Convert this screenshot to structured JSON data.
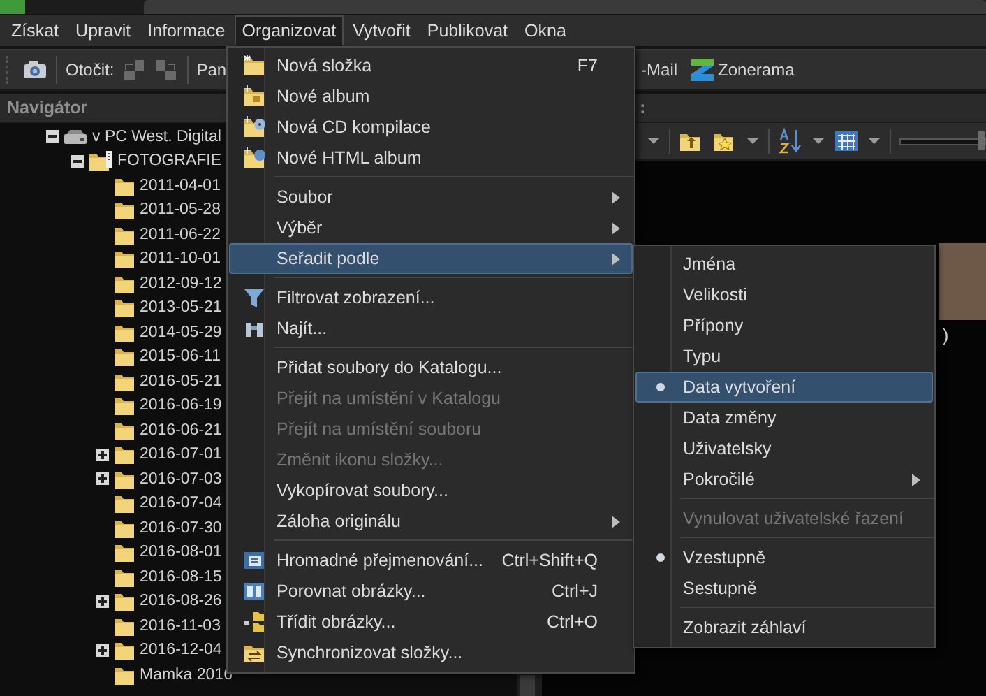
{
  "menubar": [
    {
      "label": "Získat",
      "selected": false
    },
    {
      "label": "Upravit",
      "selected": false
    },
    {
      "label": "Informace",
      "selected": false
    },
    {
      "label": "Organizovat",
      "selected": true
    },
    {
      "label": "Vytvořit",
      "selected": false
    },
    {
      "label": "Publikovat",
      "selected": false
    },
    {
      "label": "Okna",
      "selected": false
    }
  ],
  "toolbar": {
    "rotate_label": "Otočit:",
    "pan_label": "Pan",
    "mail_label": "-Mail",
    "zonerama_label": "Zonerama"
  },
  "navigator": {
    "title": "Navigátor",
    "tree": [
      {
        "label": "v PC West. Digital",
        "kind": "branch",
        "expanded": true,
        "children": [
          {
            "label": "FOTOGRAFIE",
            "kind": "branch",
            "expanded": true,
            "children": [
              {
                "label": "2011-04-01",
                "kind": "leaf"
              },
              {
                "label": "2011-05-28",
                "kind": "leaf"
              },
              {
                "label": "2011-06-22",
                "kind": "leaf"
              },
              {
                "label": "2011-10-01",
                "kind": "leaf"
              },
              {
                "label": "2012-09-12",
                "kind": "leaf"
              },
              {
                "label": "2013-05-21",
                "kind": "leaf"
              },
              {
                "label": "2014-05-29",
                "kind": "leaf"
              },
              {
                "label": "2015-06-11",
                "kind": "leaf"
              },
              {
                "label": "2016-05-21",
                "kind": "leaf"
              },
              {
                "label": "2016-06-19",
                "kind": "leaf"
              },
              {
                "label": "2016-06-21",
                "kind": "leaf"
              },
              {
                "label": "2016-07-01",
                "kind": "branch",
                "expanded": false
              },
              {
                "label": "2016-07-03",
                "kind": "branch",
                "expanded": false
              },
              {
                "label": "2016-07-04",
                "kind": "leaf"
              },
              {
                "label": "2016-07-30",
                "kind": "leaf"
              },
              {
                "label": "2016-08-01",
                "kind": "leaf"
              },
              {
                "label": "2016-08-15",
                "kind": "leaf"
              },
              {
                "label": "2016-08-26",
                "kind": "branch",
                "expanded": false
              },
              {
                "label": "2016-11-03",
                "kind": "leaf"
              },
              {
                "label": "2016-12-04",
                "kind": "branch",
                "expanded": false
              },
              {
                "label": "Mamka 2016",
                "kind": "leaf"
              }
            ]
          }
        ]
      }
    ]
  },
  "viewer": {
    "header": ":",
    "zoom_slider": {
      "level": 1
    },
    "thumbnail_caption": ")"
  },
  "menu": {
    "items": [
      {
        "kind": "item",
        "label": "Nová složka",
        "shortcut": "F7",
        "submenu": false,
        "disabled": false,
        "selected": false
      },
      {
        "kind": "item",
        "label": "Nové album",
        "submenu": false,
        "disabled": false,
        "selected": false
      },
      {
        "kind": "item",
        "label": "Nová CD kompilace",
        "submenu": false,
        "disabled": false,
        "selected": false
      },
      {
        "kind": "item",
        "label": "Nové HTML album",
        "submenu": false,
        "disabled": false,
        "selected": false
      },
      {
        "kind": "separator"
      },
      {
        "kind": "item",
        "label": "Soubor",
        "submenu": true,
        "disabled": false,
        "selected": false
      },
      {
        "kind": "item",
        "label": "Výběr",
        "submenu": true,
        "disabled": false,
        "selected": false
      },
      {
        "kind": "item",
        "label": "Seřadit podle",
        "submenu": true,
        "disabled": false,
        "selected": true
      },
      {
        "kind": "separator"
      },
      {
        "kind": "item",
        "label": "Filtrovat zobrazení...",
        "submenu": false,
        "disabled": false,
        "selected": false
      },
      {
        "kind": "item",
        "label": "Najít...",
        "submenu": false,
        "disabled": false,
        "selected": false
      },
      {
        "kind": "separator"
      },
      {
        "kind": "item",
        "label": "Přidat soubory do Katalogu...",
        "submenu": false,
        "disabled": false,
        "selected": false
      },
      {
        "kind": "item",
        "label": "Přejít na umístění v Katalogu",
        "submenu": false,
        "disabled": true,
        "selected": false
      },
      {
        "kind": "item",
        "label": "Přejít na umístění souboru",
        "submenu": false,
        "disabled": true,
        "selected": false
      },
      {
        "kind": "item",
        "label": "Změnit ikonu složky...",
        "submenu": false,
        "disabled": true,
        "selected": false
      },
      {
        "kind": "item",
        "label": "Vykopírovat soubory...",
        "submenu": false,
        "disabled": false,
        "selected": false
      },
      {
        "kind": "item",
        "label": "Záloha originálu",
        "submenu": true,
        "disabled": false,
        "selected": false
      },
      {
        "kind": "separator"
      },
      {
        "kind": "item",
        "label": "Hromadné přejmenování...",
        "shortcut": "Ctrl+Shift+Q",
        "submenu": false,
        "disabled": false,
        "selected": false
      },
      {
        "kind": "item",
        "label": "Porovnat obrázky...",
        "shortcut": "Ctrl+J",
        "submenu": false,
        "disabled": false,
        "selected": false
      },
      {
        "kind": "item",
        "label": "Třídit obrázky...",
        "shortcut": "Ctrl+O",
        "submenu": false,
        "disabled": false,
        "selected": false
      },
      {
        "kind": "item",
        "label": "Synchronizovat složky...",
        "submenu": false,
        "disabled": false,
        "selected": false
      }
    ]
  },
  "submenu": {
    "items": [
      {
        "kind": "item",
        "label": "Jména",
        "checked": false,
        "submenu": false,
        "disabled": false,
        "selected": false
      },
      {
        "kind": "item",
        "label": "Velikosti",
        "checked": false,
        "submenu": false,
        "disabled": false,
        "selected": false
      },
      {
        "kind": "item",
        "label": "Přípony",
        "checked": false,
        "submenu": false,
        "disabled": false,
        "selected": false
      },
      {
        "kind": "item",
        "label": "Typu",
        "checked": false,
        "submenu": false,
        "disabled": false,
        "selected": false
      },
      {
        "kind": "item",
        "label": "Data vytvoření",
        "checked": true,
        "submenu": false,
        "disabled": false,
        "selected": true
      },
      {
        "kind": "item",
        "label": "Data změny",
        "checked": false,
        "submenu": false,
        "disabled": false,
        "selected": false
      },
      {
        "kind": "item",
        "label": "Uživatelsky",
        "checked": false,
        "submenu": false,
        "disabled": false,
        "selected": false
      },
      {
        "kind": "item",
        "label": "Pokročilé",
        "checked": false,
        "submenu": true,
        "disabled": false,
        "selected": false
      },
      {
        "kind": "separator"
      },
      {
        "kind": "item",
        "label": "Vynulovat uživatelské řazení",
        "checked": false,
        "submenu": false,
        "disabled": true,
        "selected": false
      },
      {
        "kind": "separator"
      },
      {
        "kind": "item",
        "label": "Vzestupně",
        "checked": true,
        "submenu": false,
        "disabled": false,
        "selected": false
      },
      {
        "kind": "item",
        "label": "Sestupně",
        "checked": false,
        "submenu": false,
        "disabled": false,
        "selected": false
      },
      {
        "kind": "separator"
      },
      {
        "kind": "item",
        "label": "Zobrazit záhlaví",
        "checked": false,
        "submenu": false,
        "disabled": false,
        "selected": false
      }
    ]
  }
}
